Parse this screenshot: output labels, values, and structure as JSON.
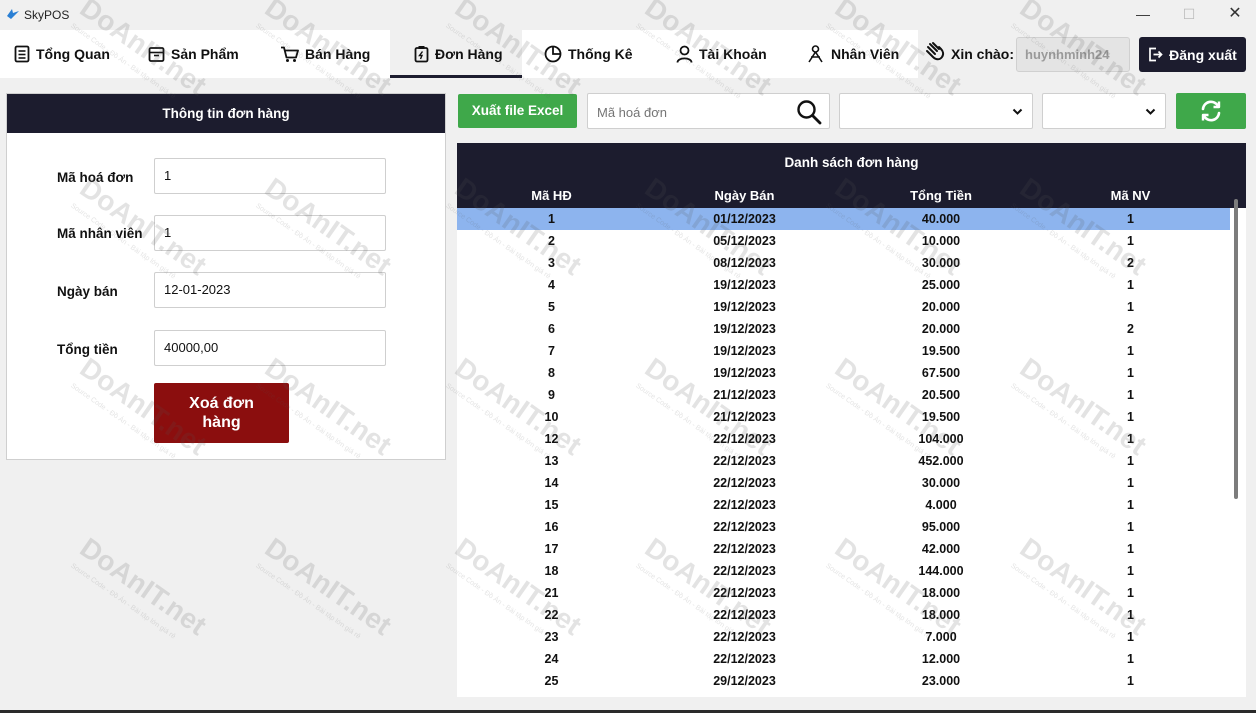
{
  "window": {
    "title": "SkyPOS",
    "app_icon": "bird-icon"
  },
  "nav": {
    "tabs": [
      {
        "label": "Tổng Quan",
        "icon": "list-icon"
      },
      {
        "label": "Sản Phẩm",
        "icon": "box-icon"
      },
      {
        "label": "Bán Hàng",
        "icon": "cart-icon"
      },
      {
        "label": "Đơn Hàng",
        "icon": "clipboard-icon",
        "active": true
      },
      {
        "label": "Thống Kê",
        "icon": "pie-chart-icon"
      },
      {
        "label": "Tài Khoản",
        "icon": "user-icon"
      },
      {
        "label": "Nhân Viên",
        "icon": "users-icon"
      }
    ],
    "greeting": "Xin chào:",
    "username": "huynhminh24",
    "logout_label": "Đăng xuất"
  },
  "order_info": {
    "title": "Thông tin đơn hàng",
    "fields": [
      {
        "label": "Mã hoá đơn",
        "value": "1"
      },
      {
        "label": "Mã nhân viên",
        "value": "1"
      },
      {
        "label": "Ngày bán",
        "value": "12-01-2023"
      },
      {
        "label": "Tổng tiền",
        "value": "40000,00"
      }
    ],
    "delete_label": "Xoá đơn hàng"
  },
  "toolbar": {
    "export_label": "Xuất file Excel",
    "search_placeholder": "Mã hoá đơn",
    "filter_1": "",
    "filter_2": ""
  },
  "orders_table": {
    "title": "Danh sách đơn hàng",
    "columns": [
      "Mã HĐ",
      "Ngày Bán",
      "Tổng Tiền",
      "Mã NV"
    ],
    "rows": [
      [
        "1",
        "01/12/2023",
        "40.000",
        "1"
      ],
      [
        "2",
        "05/12/2023",
        "10.000",
        "1"
      ],
      [
        "3",
        "08/12/2023",
        "30.000",
        "2"
      ],
      [
        "4",
        "19/12/2023",
        "25.000",
        "1"
      ],
      [
        "5",
        "19/12/2023",
        "20.000",
        "1"
      ],
      [
        "6",
        "19/12/2023",
        "20.000",
        "2"
      ],
      [
        "7",
        "19/12/2023",
        "19.500",
        "1"
      ],
      [
        "8",
        "19/12/2023",
        "67.500",
        "1"
      ],
      [
        "9",
        "21/12/2023",
        "20.500",
        "1"
      ],
      [
        "10",
        "21/12/2023",
        "19.500",
        "1"
      ],
      [
        "12",
        "22/12/2023",
        "104.000",
        "1"
      ],
      [
        "13",
        "22/12/2023",
        "452.000",
        "1"
      ],
      [
        "14",
        "22/12/2023",
        "30.000",
        "1"
      ],
      [
        "15",
        "22/12/2023",
        "4.000",
        "1"
      ],
      [
        "16",
        "22/12/2023",
        "95.000",
        "1"
      ],
      [
        "17",
        "22/12/2023",
        "42.000",
        "1"
      ],
      [
        "18",
        "22/12/2023",
        "144.000",
        "1"
      ],
      [
        "21",
        "22/12/2023",
        "18.000",
        "1"
      ],
      [
        "22",
        "22/12/2023",
        "18.000",
        "1"
      ],
      [
        "23",
        "22/12/2023",
        "7.000",
        "1"
      ],
      [
        "24",
        "22/12/2023",
        "12.000",
        "1"
      ],
      [
        "25",
        "29/12/2023",
        "23.000",
        "1"
      ]
    ],
    "selected_row": 0
  },
  "watermark": {
    "text": "DoAnIT.net",
    "subtext": "Source Code - Đồ Án - Bài tập lớn giá rẻ"
  },
  "colors": {
    "header_dark": "#1c1c2e",
    "excel_green": "#3fa84a",
    "delete_red": "#8b0e0e",
    "selected_row": "#8db4ee"
  }
}
